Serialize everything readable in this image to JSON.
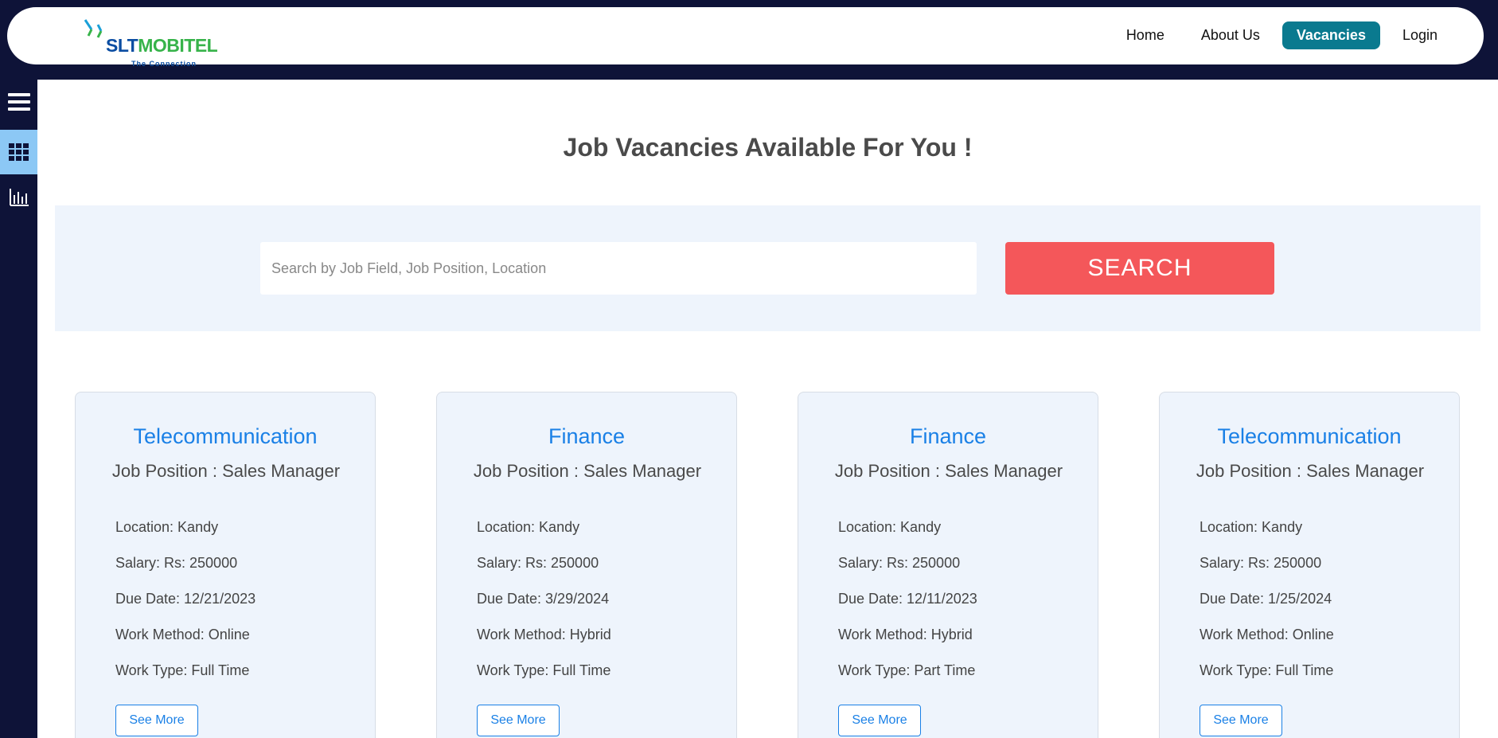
{
  "header": {
    "logo": {
      "brand_part1": "SLT",
      "brand_part2": "MOBITEL",
      "tagline": "The Connection"
    },
    "nav": [
      {
        "label": "Home",
        "active": false
      },
      {
        "label": "About Us",
        "active": false
      },
      {
        "label": "Vacancies",
        "active": true
      },
      {
        "label": "Login",
        "active": false
      }
    ]
  },
  "sidebar": {
    "items": [
      {
        "icon": "hamburger-menu-icon"
      },
      {
        "icon": "grid-icon",
        "active": true
      },
      {
        "icon": "bar-chart-icon"
      }
    ]
  },
  "main": {
    "title": "Job Vacancies Available For You !",
    "search": {
      "placeholder": "Search by Job Field, Job Position, Location",
      "value": "",
      "button_label": "SEARCH"
    },
    "jobs": [
      {
        "field": "Telecommunication",
        "position": "Job Position : Sales Manager",
        "location": "Location: Kandy",
        "salary": "Salary: Rs: 250000",
        "due_date": "Due Date: 12/21/2023",
        "work_method": "Work Method: Online",
        "work_type": "Work Type: Full Time",
        "button_label": "See More"
      },
      {
        "field": "Finance",
        "position": "Job Position : Sales Manager",
        "location": "Location: Kandy",
        "salary": "Salary: Rs: 250000",
        "due_date": "Due Date: 3/29/2024",
        "work_method": "Work Method: Hybrid",
        "work_type": "Work Type: Full Time",
        "button_label": "See More"
      },
      {
        "field": "Finance",
        "position": "Job Position : Sales Manager",
        "location": "Location: Kandy",
        "salary": "Salary: Rs: 250000",
        "due_date": "Due Date: 12/11/2023",
        "work_method": "Work Method: Hybrid",
        "work_type": "Work Type: Part Time",
        "button_label": "See More"
      },
      {
        "field": "Telecommunication",
        "position": "Job Position : Sales Manager",
        "location": "Location: Kandy",
        "salary": "Salary: Rs: 250000",
        "due_date": "Due Date: 1/25/2024",
        "work_method": "Work Method: Online",
        "work_type": "Work Type: Full Time",
        "button_label": "See More"
      }
    ]
  },
  "colors": {
    "frame_navy": "#0e1338",
    "nav_active": "#0a7a8f",
    "search_button": "#f4575a",
    "card_field": "#1a80e6",
    "panel_background": "#eef4fc",
    "sidebar_active": "#8cc8f5"
  }
}
